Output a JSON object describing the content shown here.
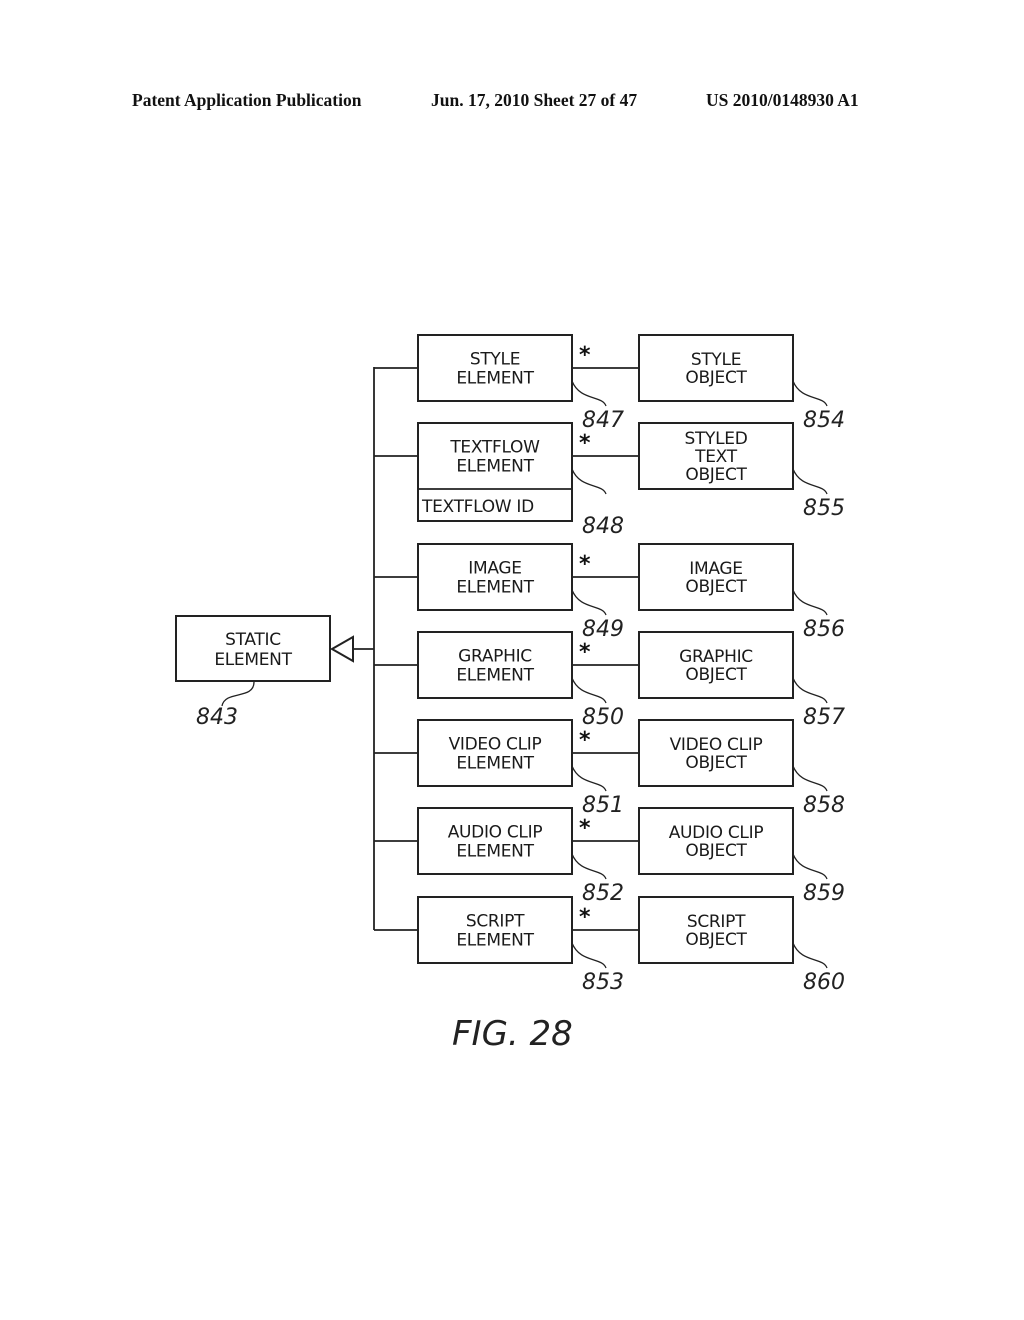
{
  "header": {
    "publication": "Patent Application Publication",
    "date_sheet": "Jun. 17, 2010  Sheet 27 of 47",
    "number": "US 2010/0148930 A1"
  },
  "figure": {
    "caption": "FIG. 28",
    "root": {
      "lines": [
        "STATIC",
        "ELEMENT"
      ],
      "ref": "843"
    },
    "multiplicity_marker": "*",
    "rows": [
      {
        "element": {
          "lines": [
            "STYLE",
            "ELEMENT"
          ],
          "ref": "847"
        },
        "object": {
          "lines": [
            "STYLE",
            "OBJECT"
          ],
          "ref": "854"
        }
      },
      {
        "element": {
          "lines": [
            "TEXTFLOW",
            "ELEMENT"
          ],
          "attribute": "TEXTFLOW ID",
          "ref": "848"
        },
        "object": {
          "lines": [
            "STYLED",
            "TEXT",
            "OBJECT"
          ],
          "ref": "855"
        }
      },
      {
        "element": {
          "lines": [
            "IMAGE",
            "ELEMENT"
          ],
          "ref": "849"
        },
        "object": {
          "lines": [
            "IMAGE",
            "OBJECT"
          ],
          "ref": "856"
        }
      },
      {
        "element": {
          "lines": [
            "GRAPHIC",
            "ELEMENT"
          ],
          "ref": "850"
        },
        "object": {
          "lines": [
            "GRAPHIC",
            "OBJECT"
          ],
          "ref": "857"
        }
      },
      {
        "element": {
          "lines": [
            "VIDEO CLIP",
            "ELEMENT"
          ],
          "ref": "851"
        },
        "object": {
          "lines": [
            "VIDEO CLIP",
            "OBJECT"
          ],
          "ref": "858"
        }
      },
      {
        "element": {
          "lines": [
            "AUDIO CLIP",
            "ELEMENT"
          ],
          "ref": "852"
        },
        "object": {
          "lines": [
            "AUDIO CLIP",
            "OBJECT"
          ],
          "ref": "859"
        }
      },
      {
        "element": {
          "lines": [
            "SCRIPT",
            "ELEMENT"
          ],
          "ref": "853"
        },
        "object": {
          "lines": [
            "SCRIPT",
            "OBJECT"
          ],
          "ref": "860"
        }
      }
    ]
  }
}
